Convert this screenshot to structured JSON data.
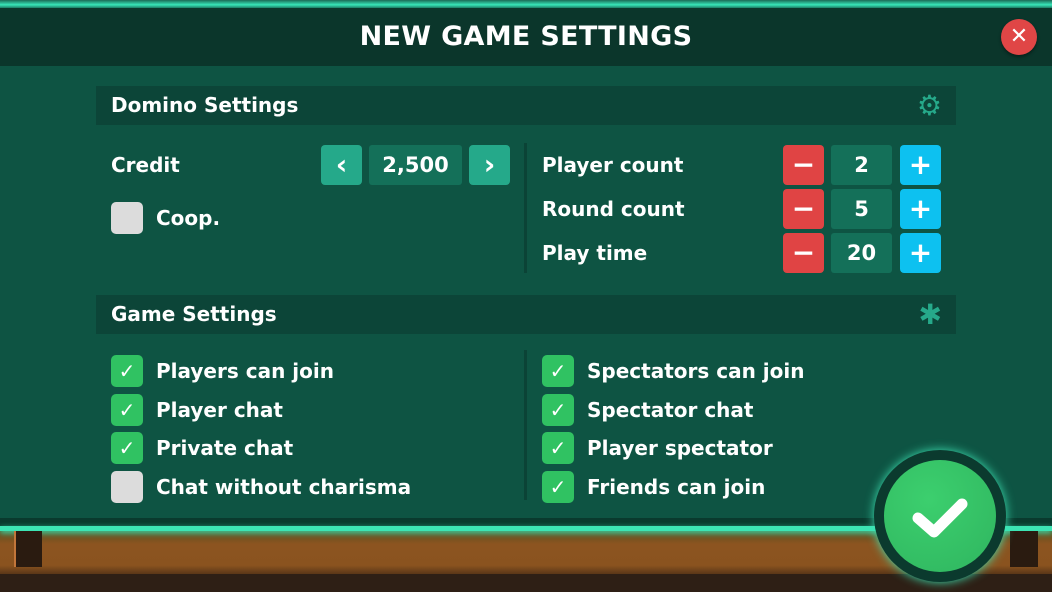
{
  "title": "NEW GAME SETTINGS",
  "close_icon": "✕",
  "domino": {
    "header": "Domino Settings",
    "header_icon": "gear-icon",
    "credit_label": "Credit",
    "credit_value": "2,500",
    "coop_label": "Coop.",
    "coop_checked": false,
    "steppers": [
      {
        "label": "Player count",
        "value": "2"
      },
      {
        "label": "Round count",
        "value": "5"
      },
      {
        "label": "Play time",
        "value": "20"
      }
    ]
  },
  "game": {
    "header": "Game Settings",
    "header_icon": "people-circle-icon",
    "left": [
      {
        "label": "Players can join",
        "checked": true
      },
      {
        "label": "Player chat",
        "checked": true
      },
      {
        "label": "Private chat",
        "checked": true
      },
      {
        "label": "Chat without charisma",
        "checked": false
      }
    ],
    "right": [
      {
        "label": "Spectators can join",
        "checked": true
      },
      {
        "label": "Spectator chat",
        "checked": true
      },
      {
        "label": "Player spectator",
        "checked": true
      },
      {
        "label": "Friends can join",
        "checked": true
      }
    ]
  },
  "colors": {
    "accent": "#25a98a",
    "minus": "#e04444",
    "plus": "#0dc1f0",
    "check": "#30c262",
    "close": "#e04646"
  }
}
